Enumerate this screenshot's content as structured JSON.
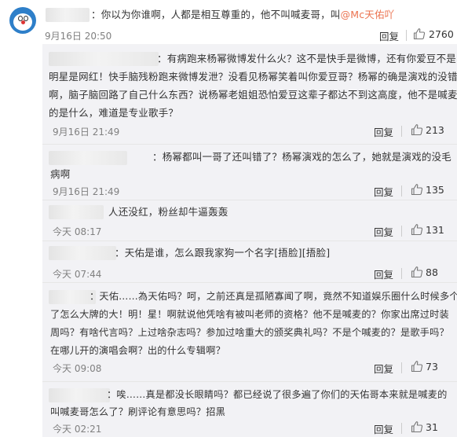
{
  "top_comment": {
    "text_before": "：你以为你谁啊，人都是相互尊重的，他不叫喊麦哥，叫",
    "mention": "@Mc天佑吖",
    "time": "9月16日 20:50",
    "reply_label": "回复",
    "likes": "2760"
  },
  "replies": [
    {
      "lines": [
        "：有病跑来杨幂微博发什么火？这不是快手是微博，还有你爱豆不是",
        "明星是网红！快手脑残粉跑来微博发泄？没看见杨幂笑着叫你爱豆哥？杨幂的确是演戏的没错",
        "啊，脑子脑回路了自己什么东西？说杨幂老姐姐恐怕爱豆这辈子都达不到这高度，他不是喊麦",
        "的是什么，难道是专业歌手？"
      ],
      "time": "9月16日 21:49",
      "reply_label": "回复",
      "likes": "213"
    },
    {
      "lines": [
        "：杨幂都叫一哥了还叫错了？杨幂演戏的怎么了，她就是演戏的没毛",
        "病啊"
      ],
      "time": "9月16日 21:49",
      "reply_label": "回复",
      "likes": "135"
    },
    {
      "lines": [
        "人还没红，粉丝却牛逼轰轰"
      ],
      "time": "今天 08:17",
      "reply_label": "回复",
      "likes": "131"
    },
    {
      "lines": [
        "：天佑是谁，怎么跟我家狗一个名字[捂脸][捂脸]"
      ],
      "time": "今天 07:44",
      "reply_label": "回复",
      "likes": "88"
    },
    {
      "lines": [
        "：天佑……為天佑吗？呵，之前还真是孤陋寡闻了啊，竟然不知道娱乐圈什么时候多个",
        "了怎么大牌的大！明！星！啊就说他凭啥有被叫老师的资格？他不是喊麦的？你家出席过时装",
        "周吗？有啥代言吗？上过啥杂志吗？参加过啥重大的颁奖典礼吗？不是个喊麦的？是歌手吗？",
        "在哪儿开的演唱会啊？出的什么专辑啊？"
      ],
      "time": "今天 09:08",
      "reply_label": "回复",
      "likes": "73"
    },
    {
      "lines": [
        "：唉……真是都没长眼睛吗？都已经说了很多遍了你们的天佑哥本来就是喊麦的",
        "叫喊麦哥怎么了？刷评论有意思吗？招黑"
      ],
      "time": "今天 02:21",
      "reply_label": "回复",
      "likes": "31"
    }
  ],
  "icons": {
    "avatar": "avatar-icon",
    "like": "thumbs-up-icon"
  }
}
